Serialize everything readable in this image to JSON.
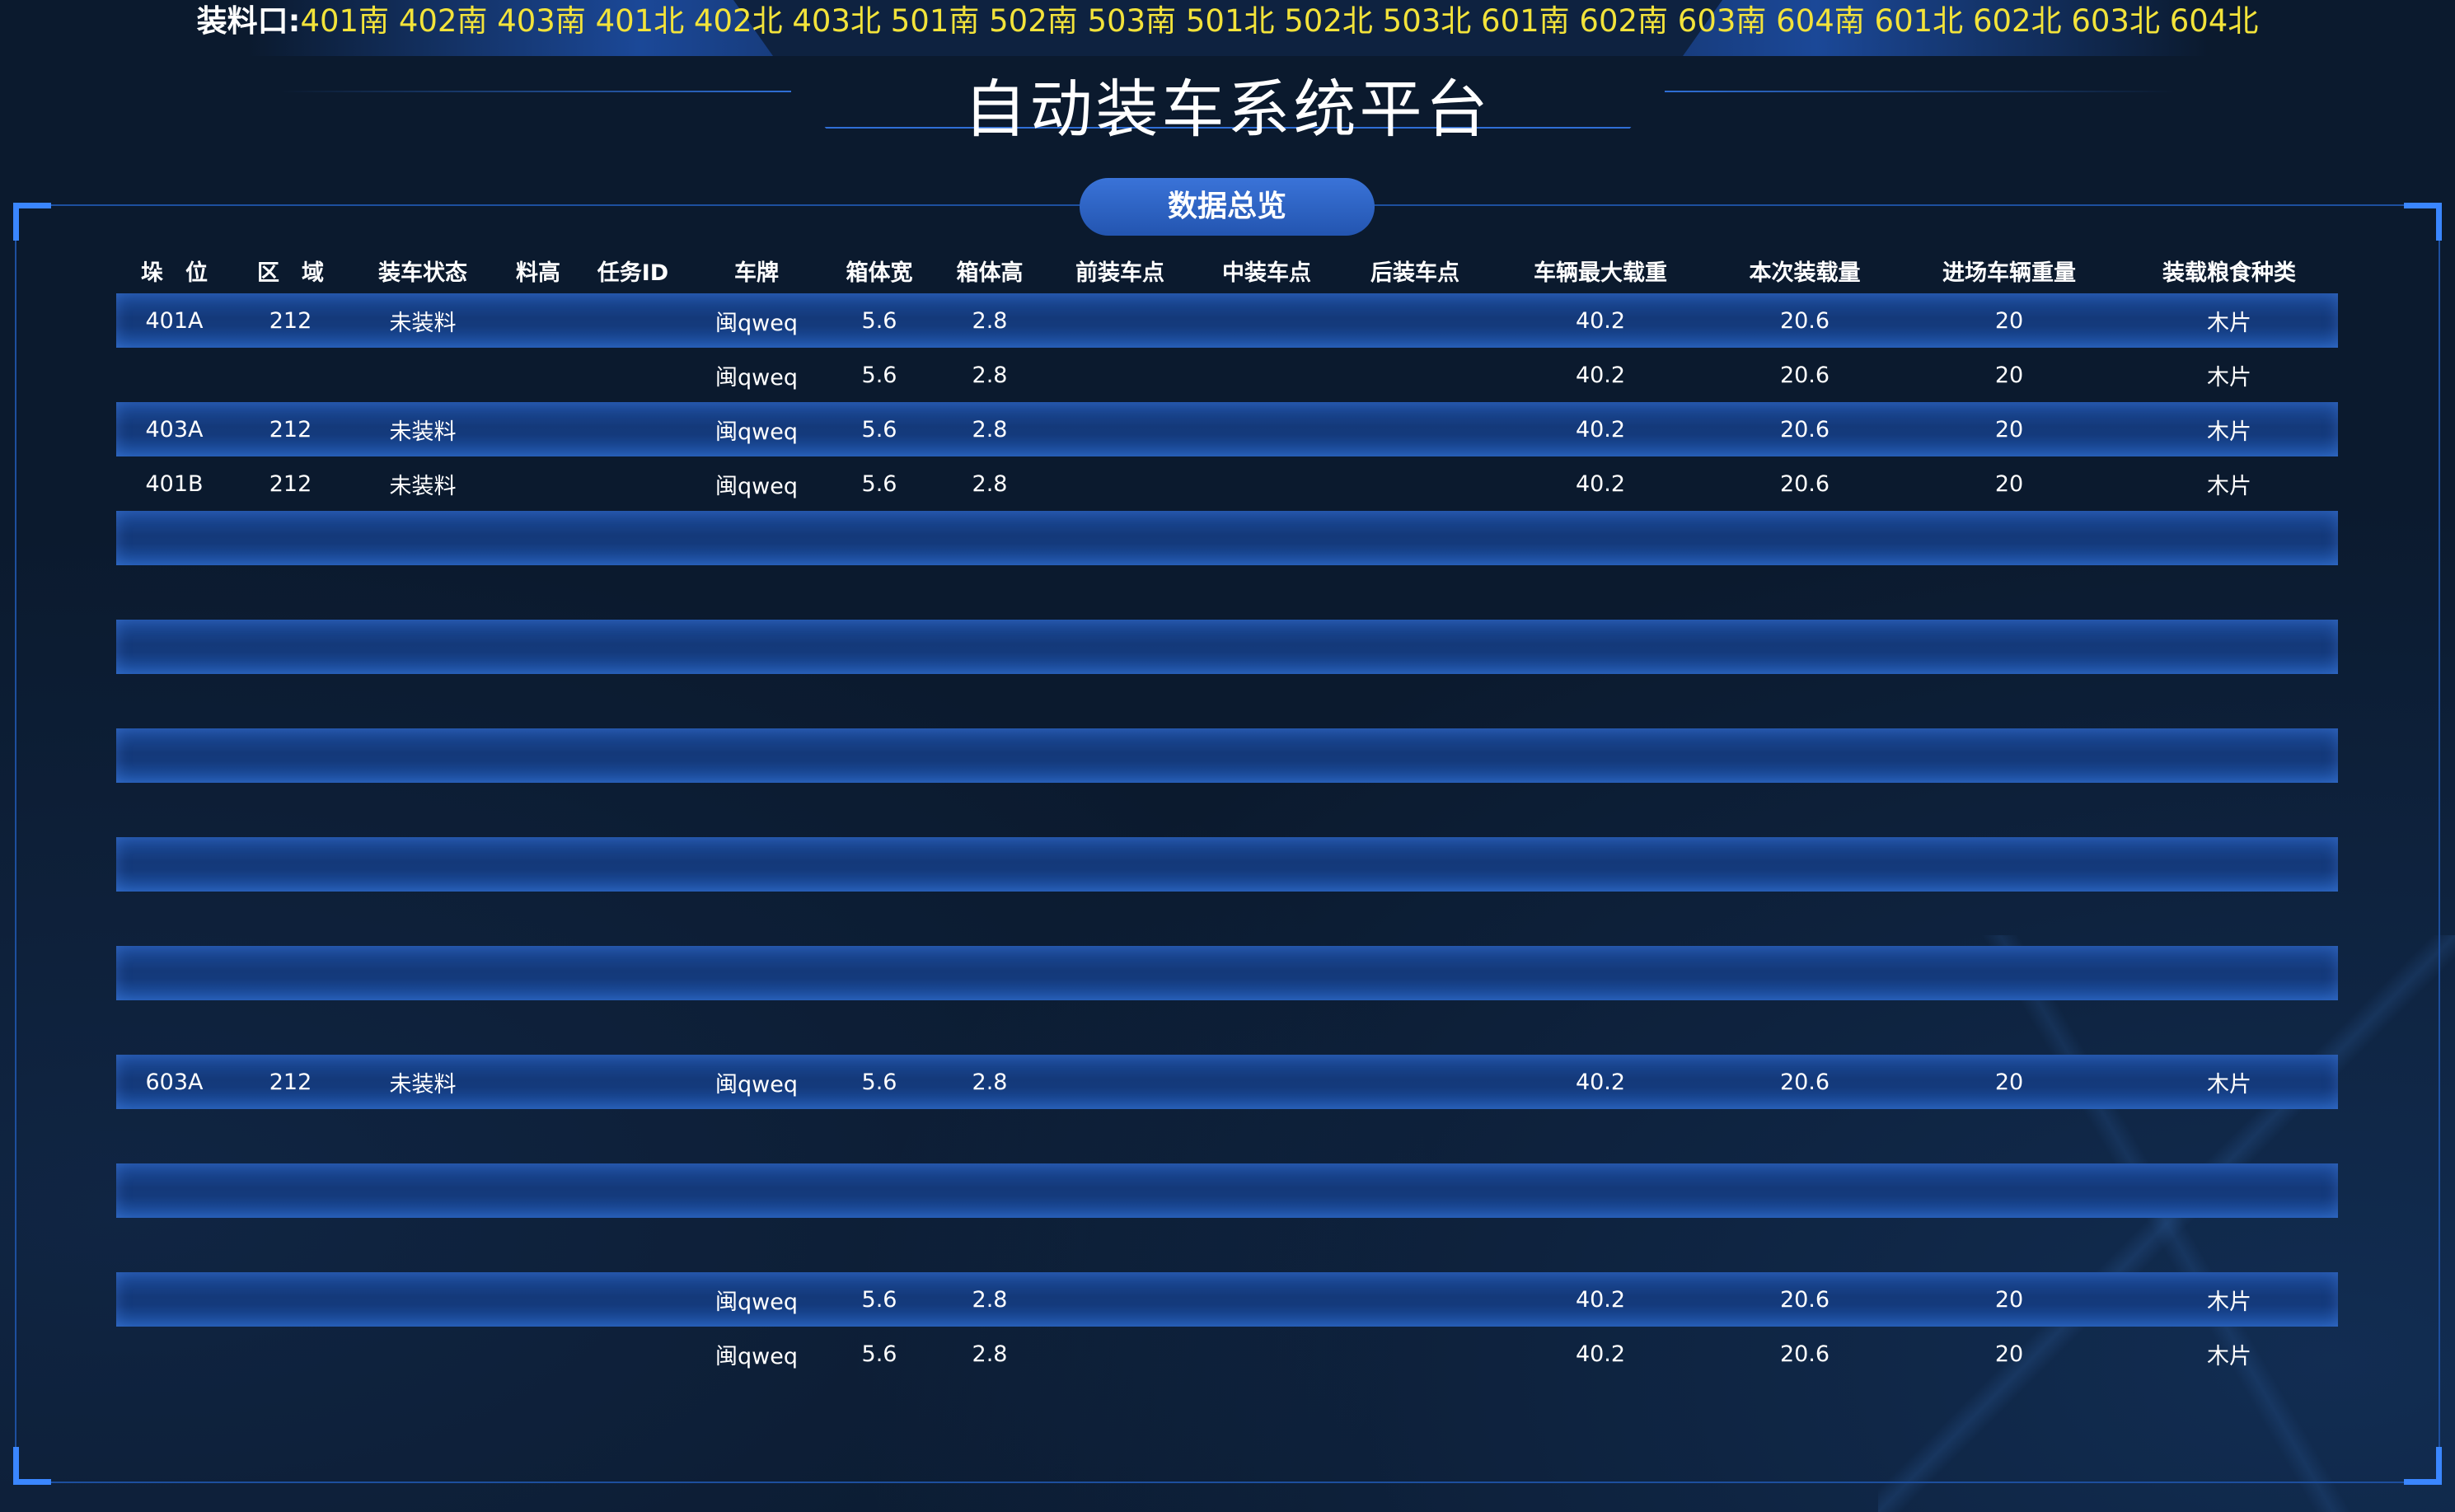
{
  "header": {
    "ports_label": "装料口:",
    "ports_list": "401南 402南 403南 401北 402北 403北 501南 502南 503南 501北 502北 503北 601南 602南 603南 604南 601北 602北 603北 604北",
    "title": "自动装车系统平台"
  },
  "panel": {
    "badge": "数据总览"
  },
  "table": {
    "columns": [
      "垛　位",
      "区　域",
      "装车状态",
      "料高",
      "任务ID",
      "车牌",
      "箱体宽",
      "箱体高",
      "前装车点",
      "中装车点",
      "后装车点",
      "车辆最大载重",
      "本次装载量",
      "进场车辆重量",
      "装载粮食种类"
    ],
    "rows": [
      [
        "401A",
        "212",
        "未装料",
        "",
        "",
        "闽qweq",
        "5.6",
        "2.8",
        "",
        "",
        "",
        "40.2",
        "20.6",
        "20",
        "木片"
      ],
      [
        "",
        "",
        "",
        "",
        "",
        "闽qweq",
        "5.6",
        "2.8",
        "",
        "",
        "",
        "40.2",
        "20.6",
        "20",
        "木片"
      ],
      [
        "403A",
        "212",
        "未装料",
        "",
        "",
        "闽qweq",
        "5.6",
        "2.8",
        "",
        "",
        "",
        "40.2",
        "20.6",
        "20",
        "木片"
      ],
      [
        "401B",
        "212",
        "未装料",
        "",
        "",
        "闽qweq",
        "5.6",
        "2.8",
        "",
        "",
        "",
        "40.2",
        "20.6",
        "20",
        "木片"
      ],
      [
        "",
        "",
        "",
        "",
        "",
        "",
        "",
        "",
        "",
        "",
        "",
        "",
        "",
        "",
        ""
      ],
      [
        "",
        "",
        "",
        "",
        "",
        "",
        "",
        "",
        "",
        "",
        "",
        "",
        "",
        "",
        ""
      ],
      [
        "",
        "",
        "",
        "",
        "",
        "",
        "",
        "",
        "",
        "",
        "",
        "",
        "",
        "",
        ""
      ],
      [
        "",
        "",
        "",
        "",
        "",
        "",
        "",
        "",
        "",
        "",
        "",
        "",
        "",
        "",
        ""
      ],
      [
        "",
        "",
        "",
        "",
        "",
        "",
        "",
        "",
        "",
        "",
        "",
        "",
        "",
        "",
        ""
      ],
      [
        "",
        "",
        "",
        "",
        "",
        "",
        "",
        "",
        "",
        "",
        "",
        "",
        "",
        "",
        ""
      ],
      [
        "",
        "",
        "",
        "",
        "",
        "",
        "",
        "",
        "",
        "",
        "",
        "",
        "",
        "",
        ""
      ],
      [
        "",
        "",
        "",
        "",
        "",
        "",
        "",
        "",
        "",
        "",
        "",
        "",
        "",
        "",
        ""
      ],
      [
        "",
        "",
        "",
        "",
        "",
        "",
        "",
        "",
        "",
        "",
        "",
        "",
        "",
        "",
        ""
      ],
      [
        "",
        "",
        "",
        "",
        "",
        "",
        "",
        "",
        "",
        "",
        "",
        "",
        "",
        "",
        ""
      ],
      [
        "603A",
        "212",
        "未装料",
        "",
        "",
        "闽qweq",
        "5.6",
        "2.8",
        "",
        "",
        "",
        "40.2",
        "20.6",
        "20",
        "木片"
      ],
      [
        "",
        "",
        "",
        "",
        "",
        "",
        "",
        "",
        "",
        "",
        "",
        "",
        "",
        "",
        ""
      ],
      [
        "",
        "",
        "",
        "",
        "",
        "",
        "",
        "",
        "",
        "",
        "",
        "",
        "",
        "",
        ""
      ],
      [
        "",
        "",
        "",
        "",
        "",
        "",
        "",
        "",
        "",
        "",
        "",
        "",
        "",
        "",
        ""
      ],
      [
        "",
        "",
        "",
        "",
        "",
        "闽qweq",
        "5.6",
        "2.8",
        "",
        "",
        "",
        "40.2",
        "20.6",
        "20",
        "木片"
      ],
      [
        "",
        "",
        "",
        "",
        "",
        "闽qweq",
        "5.6",
        "2.8",
        "",
        "",
        "",
        "40.2",
        "20.6",
        "20",
        "木片"
      ]
    ]
  },
  "colors": {
    "background": "#0b1a2e",
    "accent": "#2f6fd6",
    "ports_highlight": "#f3e33a",
    "row_stripe": "#1c4c9c"
  }
}
